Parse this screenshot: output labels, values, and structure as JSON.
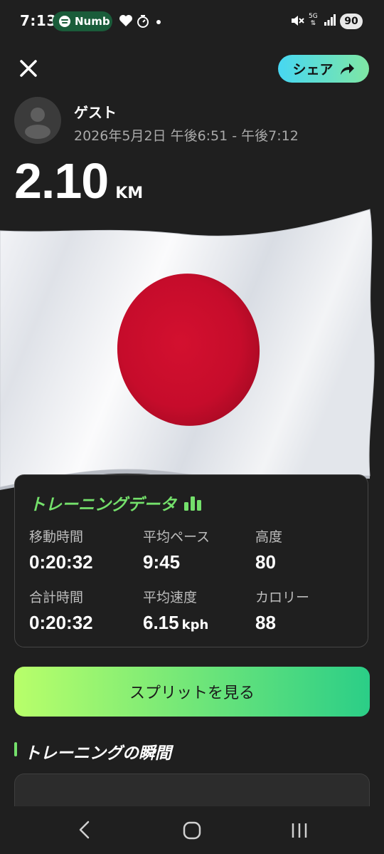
{
  "status_bar": {
    "time": "7:13",
    "media_app": "Numb",
    "network": "5G",
    "battery": "90",
    "icons": [
      "spotify-icon",
      "heart-icon",
      "timer-icon",
      "dot-icon",
      "mute-icon",
      "signal-icon"
    ]
  },
  "header": {
    "close_icon": "close-icon",
    "share_label": "シェア",
    "share_icon": "share-arrow-icon"
  },
  "user": {
    "name": "ゲスト",
    "session_time": "2026年5月2日 午後6:51 - 午後7:12"
  },
  "distance": {
    "value": "2.10",
    "unit": "KM"
  },
  "training_data": {
    "title": "トレーニングデータ",
    "title_icon": "bar-chart-icon",
    "stats": [
      {
        "label": "移動時間",
        "value": "0:20:32",
        "unit": ""
      },
      {
        "label": "平均ペース",
        "value": "9:45",
        "unit": ""
      },
      {
        "label": "高度",
        "value": "80",
        "unit": ""
      },
      {
        "label": "合計時間",
        "value": "0:20:32",
        "unit": ""
      },
      {
        "label": "平均速度",
        "value": "6.15",
        "unit": "kph"
      },
      {
        "label": "カロリー",
        "value": "88",
        "unit": ""
      }
    ]
  },
  "split_button": {
    "label": "スプリットを見る"
  },
  "moments": {
    "title": "トレーニングの瞬間"
  },
  "colors": {
    "background": "#1f1f1f",
    "accent_green": "#74e06b",
    "flag_red": "#c8102e",
    "share_gradient_start": "#47d7f2",
    "share_gradient_end": "#7fe7a4",
    "split_gradient_start": "#b8ff6a",
    "split_gradient_end": "#2bce87"
  },
  "nav_bar": {
    "icons": [
      "back-icon",
      "home-icon",
      "recent-apps-icon"
    ]
  }
}
